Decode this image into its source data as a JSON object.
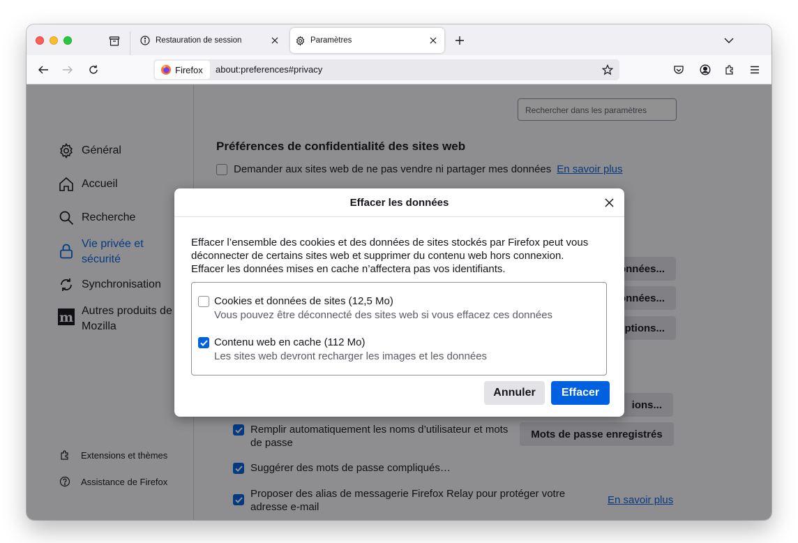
{
  "browser": {
    "brand": "Firefox",
    "url": "about:preferences#privacy",
    "tabs": [
      {
        "label": "Restauration de session",
        "active": false
      },
      {
        "label": "Paramètres",
        "active": true
      }
    ]
  },
  "sidebar": {
    "items": [
      {
        "label": "Général",
        "icon": "gear-icon"
      },
      {
        "label": "Accueil",
        "icon": "home-icon"
      },
      {
        "label": "Recherche",
        "icon": "search-icon"
      },
      {
        "label": "Vie privée et sécurité",
        "line1": "Vie privée et",
        "line2": "sécurité",
        "icon": "lock-icon",
        "active": true
      },
      {
        "label": "Synchronisation",
        "icon": "sync-icon"
      },
      {
        "label": "Autres produits de Mozilla",
        "line1": "Autres produits de",
        "line2": "Mozilla",
        "icon": "mozilla-icon"
      }
    ],
    "footer": [
      {
        "label": "Extensions et thèmes",
        "icon": "puzzle-icon"
      },
      {
        "label": "Assistance de Firefox",
        "icon": "help-icon"
      }
    ]
  },
  "main": {
    "search_placeholder": "Rechercher dans les paramètres",
    "section_title": "Préférences de confidentialité des sites web",
    "dnt_label": "Demander aux sites web de ne pas vendre ni partager mes données",
    "learn_more": "En savoir plus",
    "partial_buttons": [
      "onnées...",
      "onnées...",
      "eptions...",
      "ions..."
    ],
    "autofill_label_1": "Remplir automatiquement les noms d’utilisateur et mots",
    "autofill_label_2": "de passe",
    "saved_logins_button": "Mots de passe enregistrés",
    "suggest_passwords": "Suggérer des mots de passe compliqués…",
    "relay_label_1": "Proposer des alias de messagerie Firefox Relay pour protéger votre",
    "relay_label_2": "adresse e-mail",
    "relay_learn_more": "En savoir plus"
  },
  "dialog": {
    "title": "Effacer les données",
    "description_1": "Effacer l’ensemble des cookies et des données de sites stockés par Firefox peut vous",
    "description_2": "déconnecter de certains sites web et supprimer du contenu web hors connexion.",
    "description_3": "Effacer les données mises en cache n’affectera pas vos identifiants.",
    "options": [
      {
        "label": "Cookies et données de sites (12,5 Mo)",
        "description": "Vous pouvez être déconnecté des sites web si vous effacez ces données",
        "checked": false
      },
      {
        "label": "Contenu web en cache (112 Mo)",
        "description": "Les sites web devront recharger les images et les données",
        "checked": true
      }
    ],
    "cancel_label": "Annuler",
    "confirm_label": "Effacer"
  },
  "colors": {
    "accent": "#0061e0",
    "overlay": "rgba(12,12,13,0.45)"
  }
}
